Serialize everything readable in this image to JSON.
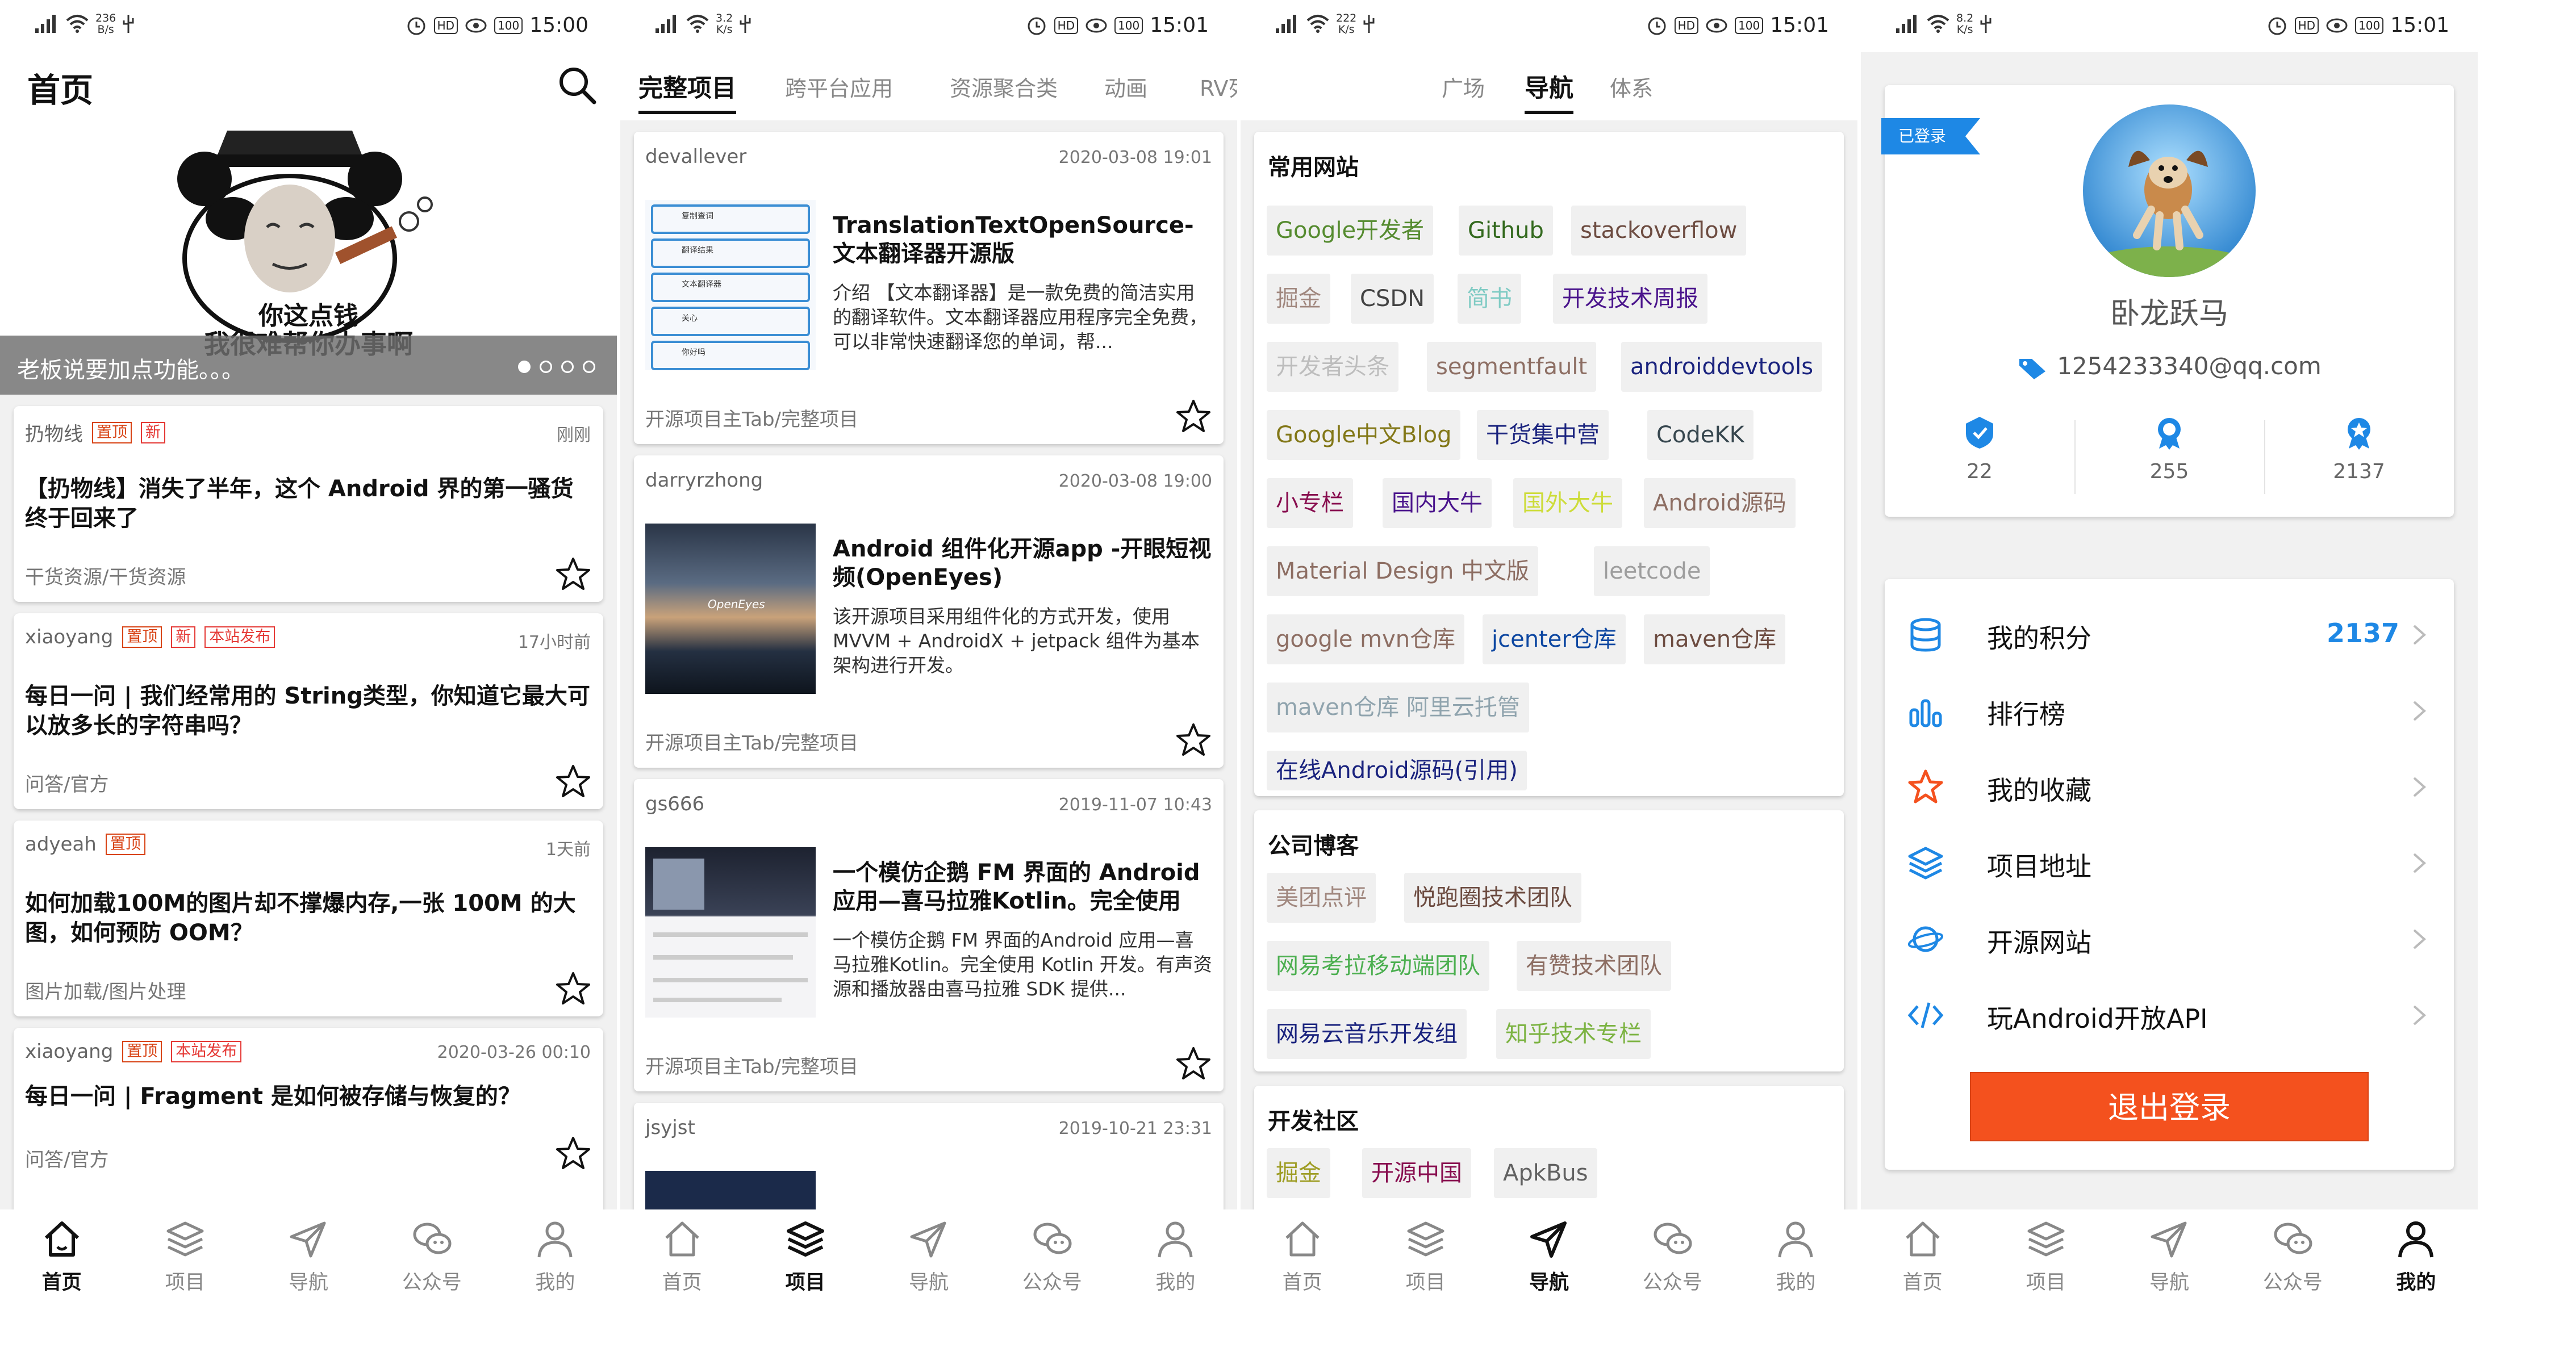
{
  "status_bars": [
    {
      "speed_top": "236",
      "speed_unit": "B/s",
      "battery": "100",
      "time": "15:00"
    },
    {
      "speed_top": "3.2",
      "speed_unit": "K/s",
      "battery": "100",
      "time": "15:01"
    },
    {
      "speed_top": "222",
      "speed_unit": "K/s",
      "battery": "100",
      "time": "15:01"
    },
    {
      "speed_top": "8.2",
      "speed_unit": "K/s",
      "battery": "100",
      "time": "15:01"
    }
  ],
  "home": {
    "title": "首页",
    "banner": {
      "line1": "你这点钱",
      "line2": "我很难帮你办事啊",
      "caption": "老板说要加点功能。。。"
    },
    "articles": [
      {
        "author": "扔物线",
        "tags": [
          "置顶",
          "新"
        ],
        "time": "刚刚",
        "title": "【扔物线】消失了半年，这个 Android 界的第一骚货终于回来了",
        "chapter": "干货资源/干货资源"
      },
      {
        "author": "xiaoyang",
        "tags": [
          "置顶",
          "新",
          "本站发布"
        ],
        "time": "17小时前",
        "title": "每日一问 | 我们经常用的 String类型，你知道它最大可以放多长的字符串吗？",
        "chapter": "问答/官方"
      },
      {
        "author": "adyeah",
        "tags": [
          "置顶"
        ],
        "time": "1天前",
        "title": "如何加载100M的图片却不撑爆内存,一张 100M 的大图，如何预防 OOM？",
        "chapter": "图片加载/图片处理"
      },
      {
        "author": "xiaoyang",
        "tags": [
          "置顶",
          "本站发布"
        ],
        "time": "2020-03-26 00:10",
        "title": "每日一问 | Fragment 是如何被存储与恢复的？",
        "chapter": "问答/官方"
      }
    ]
  },
  "project": {
    "tabs": [
      "完整项目",
      "跨平台应用",
      "资源聚合类",
      "动画",
      "RV列"
    ],
    "items": [
      {
        "author": "devallever",
        "time": "2020-03-08 19:01",
        "title": "TranslationTextOpenSource-文本翻译器开源版",
        "desc": "介绍 【文本翻译器】是一款免费的简洁实用的翻译软件。文本翻译器应用程序完全免费，可以非常快速翻译您的单词，帮...",
        "chapter": "开源项目主Tab/完整项目"
      },
      {
        "author": "darryrzhong",
        "time": "2020-03-08 19:00",
        "title": "Android 组件化开源app -开眼短视频(OpenEyes)",
        "desc": "该开源项目采用组件化的方式开发，使用 MVVM + AndroidX + jetpack 组件为基本架构进行开发。",
        "chapter": "开源项目主Tab/完整项目"
      },
      {
        "author": "gs666",
        "time": "2019-11-07 10:43",
        "title": "一个模仿企鹅 FM 界面的 Android 应用—喜马拉雅Kotlin。完全使用 ...",
        "desc": "一个模仿企鹅 FM 界面的Android 应用—喜马拉雅Kotlin。完全使用 Kotlin 开发。有声资源和播放器由喜马拉雅 SDK 提供...",
        "chapter": "开源项目主Tab/完整项目"
      },
      {
        "author": "jsyjst",
        "time": "2019-10-21 23:31",
        "title": "",
        "desc": "",
        "chapter": ""
      }
    ],
    "thumb_texts": {
      "t1": [
        "复制查词",
        "翻译结果",
        "文本翻译器",
        "关心",
        "你好吗"
      ],
      "t2": "OpenEyes"
    }
  },
  "nav": {
    "tabs": [
      "广场",
      "导航",
      "体系"
    ],
    "groups": [
      {
        "title": "常用网站",
        "links": [
          {
            "text": "Google开发者",
            "color": "#558b2f"
          },
          {
            "text": "Github",
            "color": "#33691e"
          },
          {
            "text": "stackoverflow",
            "color": "#6d4c41"
          },
          {
            "text": "掘金",
            "color": "#a1887f"
          },
          {
            "text": "CSDN",
            "color": "#424242"
          },
          {
            "text": "简书",
            "color": "#80cbc4"
          },
          {
            "text": "开发技术周报",
            "color": "#4a148c"
          },
          {
            "text": "开发者头条",
            "color": "#bdbdbd"
          },
          {
            "text": "segmentfault",
            "color": "#8d6e63"
          },
          {
            "text": "androiddevtools",
            "color": "#1a237e"
          },
          {
            "text": "Google中文Blog",
            "color": "#827717"
          },
          {
            "text": "干货集中营",
            "color": "#1a237e"
          },
          {
            "text": "CodeKK",
            "color": "#37474f"
          },
          {
            "text": "小专栏",
            "color": "#880e4f"
          },
          {
            "text": "国内大牛",
            "color": "#4a148c"
          },
          {
            "text": "国外大牛",
            "color": "#cddc39"
          },
          {
            "text": "Android源码",
            "color": "#8d6e63"
          },
          {
            "text": "Material Design 中文版",
            "color": "#8d6e63"
          },
          {
            "text": "leetcode",
            "color": "#9e9e9e"
          },
          {
            "text": "google mvn仓库",
            "color": "#8d6e63"
          },
          {
            "text": "jcenter仓库",
            "color": "#0d47a1"
          },
          {
            "text": "maven仓库",
            "color": "#6d4c41"
          },
          {
            "text": "maven仓库 阿里云托管",
            "color": "#90a4ae"
          },
          {
            "text": "在线Android源码(引用)",
            "color": "#1a237e"
          }
        ]
      },
      {
        "title": "公司博客",
        "links": [
          {
            "text": "美团点评",
            "color": "#a1887f"
          },
          {
            "text": "悦跑圈技术团队",
            "color": "#6d4c41"
          },
          {
            "text": "网易考拉移动端团队",
            "color": "#4caf50"
          },
          {
            "text": "有赞技术团队",
            "color": "#8d6e63"
          },
          {
            "text": "网易云音乐开发组",
            "color": "#1a237e"
          },
          {
            "text": "知乎技术专栏",
            "color": "#7cb342"
          }
        ]
      },
      {
        "title": "开发社区",
        "links": [
          {
            "text": "掘金",
            "color": "#9e9d24"
          },
          {
            "text": "开源中国",
            "color": "#880e4f"
          },
          {
            "text": "ApkBus",
            "color": "#616161"
          }
        ]
      }
    ]
  },
  "mine": {
    "login_tag": "已登录",
    "name": "卧龙跃马",
    "email": "1254233340@qq.com",
    "stats": [
      {
        "value": "22",
        "icon": "rank-badge-icon"
      },
      {
        "value": "255",
        "icon": "level-badge-icon"
      },
      {
        "value": "2137",
        "icon": "coin-badge-icon"
      }
    ],
    "menu": [
      {
        "label": "我的积分",
        "value": "2137"
      },
      {
        "label": "排行榜",
        "value": ""
      },
      {
        "label": "我的收藏",
        "value": ""
      },
      {
        "label": "项目地址",
        "value": ""
      },
      {
        "label": "开源网站",
        "value": ""
      },
      {
        "label": "玩Android开放API",
        "value": ""
      }
    ],
    "logout": "退出登录"
  },
  "bottom_nav": [
    "首页",
    "项目",
    "导航",
    "公众号",
    "我的"
  ],
  "colors": {
    "accent": "#1e88e5",
    "tag_red": "#e53935",
    "logout": "#f4511e"
  }
}
